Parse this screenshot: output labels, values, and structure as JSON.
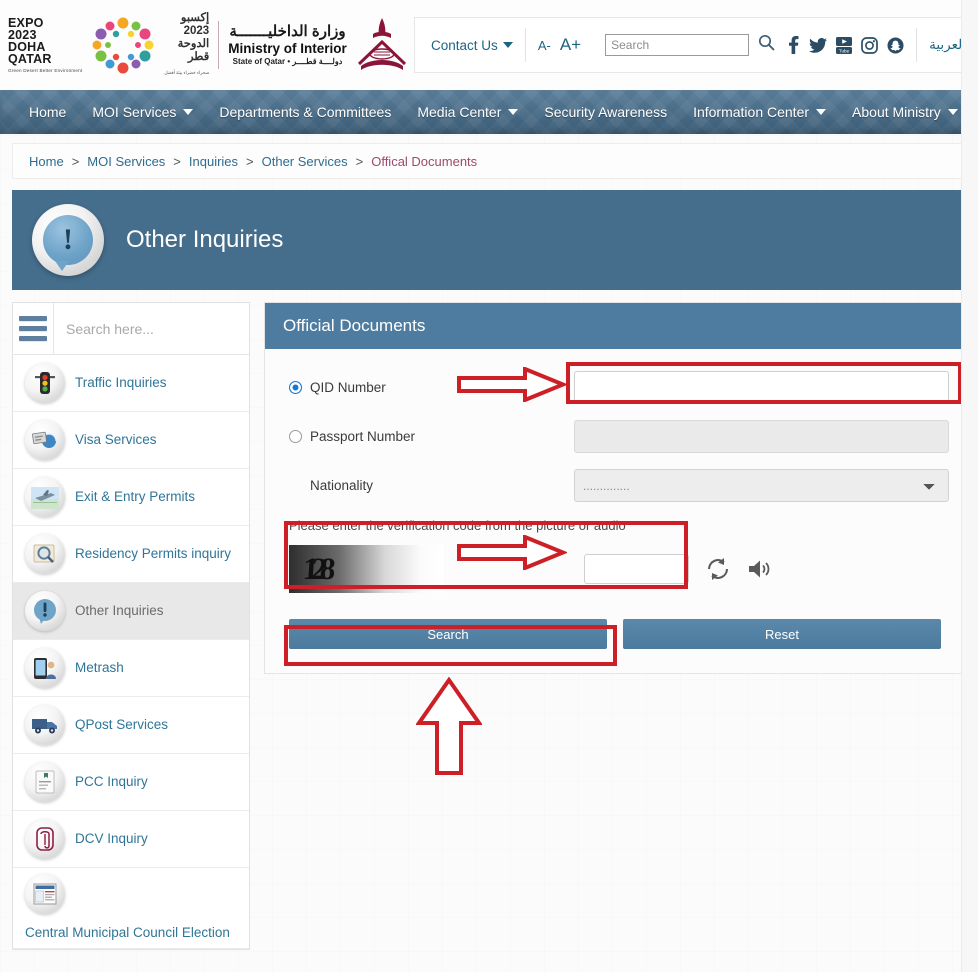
{
  "header": {
    "expo": {
      "line1": "EXPO",
      "line2": "2023",
      "line3": "DOHA",
      "line4": "QATAR",
      "tagline": "Green Desert\nBetter Environment",
      "ar_line1": "إكسبو",
      "ar_line2": "2023",
      "ar_line3": "الدوحة",
      "ar_line4": "قطر",
      "ar_tagline": "صحراء خضراء\nبيئة أفضل"
    },
    "ministry": {
      "arabic": "وزارة الداخليـــــــة",
      "english": "Ministry of Interior",
      "state": "State of Qatar • دولــــة قطــــر"
    },
    "contact_us": "Contact Us",
    "font_decrease": "A-",
    "font_increase": "A+",
    "search_placeholder": "Search",
    "search_value": "",
    "arabic_link": "العربية",
    "social": [
      {
        "name": "facebook-icon",
        "label": "f"
      },
      {
        "name": "twitter-icon",
        "label": "twitter"
      },
      {
        "name": "youtube-icon",
        "label": "YouTube"
      },
      {
        "name": "instagram-icon",
        "label": "Instagram"
      },
      {
        "name": "snapchat-icon",
        "label": "Snapchat"
      }
    ]
  },
  "nav": {
    "items": [
      {
        "label": "Home",
        "has_caret": false
      },
      {
        "label": "MOI Services",
        "has_caret": true
      },
      {
        "label": "Departments & Committees",
        "has_caret": false
      },
      {
        "label": "Media Center",
        "has_caret": true
      },
      {
        "label": "Security Awareness",
        "has_caret": false
      },
      {
        "label": "Information Center",
        "has_caret": true
      },
      {
        "label": "About Ministry",
        "has_caret": true
      }
    ]
  },
  "breadcrumb": {
    "separator": ">",
    "items": [
      {
        "label": "Home",
        "current": false
      },
      {
        "label": "MOI Services",
        "current": false
      },
      {
        "label": "Inquiries",
        "current": false
      },
      {
        "label": "Other Services",
        "current": false
      },
      {
        "label": "Offical Documents",
        "current": true
      }
    ]
  },
  "banner": {
    "title": "Other Inquiries",
    "icon": "exclamation-bubble-icon"
  },
  "sidebar": {
    "menu_icon": "hamburger-icon",
    "search_placeholder": "Search here...",
    "search_value": "",
    "items": [
      {
        "label": "Traffic Inquiries",
        "icon": "traffic-light-icon",
        "active": false
      },
      {
        "label": "Visa Services",
        "icon": "globe-visa-icon",
        "active": false
      },
      {
        "label": "Exit & Entry Permits",
        "icon": "airplane-icon",
        "active": false
      },
      {
        "label": "Residency Permits inquiry",
        "icon": "magnifier-document-icon",
        "active": false
      },
      {
        "label": "Other Inquiries",
        "icon": "exclamation-bubble-icon",
        "active": true
      },
      {
        "label": "Metrash",
        "icon": "mobile-phone-icon",
        "active": false
      },
      {
        "label": "QPost Services",
        "icon": "delivery-van-icon",
        "active": false
      },
      {
        "label": "PCC Inquiry",
        "icon": "certificate-icon",
        "active": false
      },
      {
        "label": "DCV Inquiry",
        "icon": "fingerprint-icon",
        "active": false
      },
      {
        "label": "Central Municipal Council Election",
        "icon": "ballot-icon",
        "active": false
      }
    ]
  },
  "form": {
    "title": "Official Documents",
    "qid": {
      "label": "QID Number",
      "selected": true,
      "value": "",
      "placeholder": ""
    },
    "passport": {
      "label": "Passport Number",
      "selected": false,
      "value": "",
      "placeholder": "",
      "disabled": true
    },
    "nationality": {
      "label": "Nationality",
      "selected_value": "..............",
      "options": [
        ".............."
      ]
    },
    "captcha": {
      "hint": "Please enter the verification code from the picture or audio",
      "image_text": "128",
      "input_value": "",
      "refresh_icon": "refresh-icon",
      "audio_icon": "speaker-icon"
    },
    "buttons": {
      "search": "Search",
      "reset": "Reset"
    }
  },
  "annotations": {
    "color": "#cc2026",
    "marks": [
      {
        "name": "qid-input-highlight",
        "type": "box"
      },
      {
        "name": "qid-arrow",
        "type": "arrow-right"
      },
      {
        "name": "captcha-highlight",
        "type": "box"
      },
      {
        "name": "captcha-arrow",
        "type": "arrow-right"
      },
      {
        "name": "search-button-highlight",
        "type": "box"
      },
      {
        "name": "search-button-arrow",
        "type": "arrow-up"
      }
    ]
  },
  "colors": {
    "nav_blue": "#456d8c",
    "panel_header_blue": "#4d7ca0",
    "link_blue": "#2f7598",
    "annotation_red": "#cc2026",
    "button_blue": "#4b7a9d"
  }
}
